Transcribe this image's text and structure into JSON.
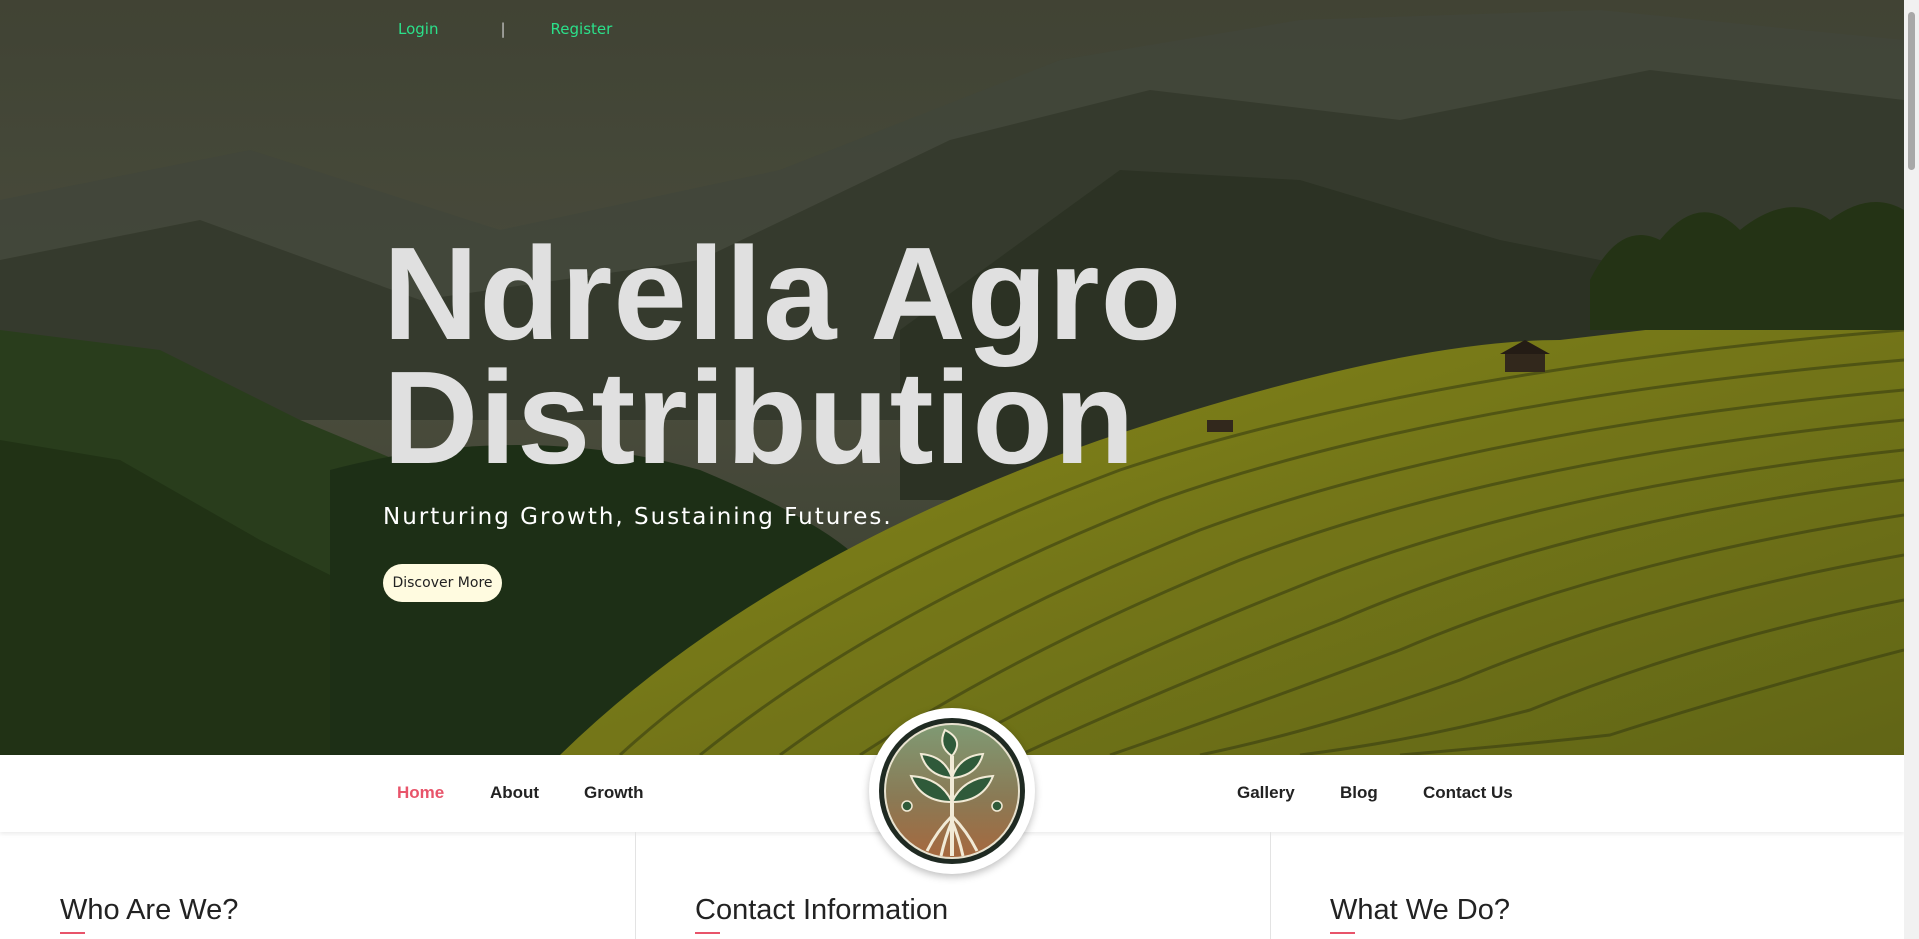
{
  "auth": {
    "login": "Login",
    "separator": "|",
    "register": "Register"
  },
  "hero": {
    "title_line1": "Ndrella Agro",
    "title_line2": "Distribution",
    "tagline": "Nurturing Growth, Sustaining Futures.",
    "cta": "Discover More"
  },
  "nav": {
    "left": [
      "Home",
      "About",
      "Growth"
    ],
    "right": [
      "Gallery",
      "Blog",
      "Contact Us"
    ],
    "active": "Home"
  },
  "sections": [
    {
      "title": "Who Are We?"
    },
    {
      "title": "Contact Information"
    },
    {
      "title": "What We Do?"
    }
  ],
  "colors": {
    "accent": "#e8546a",
    "auth_link": "#2be08a",
    "cta_bg": "#fffbe0"
  },
  "icons": {
    "logo": "plant-leaf-logo-icon"
  }
}
